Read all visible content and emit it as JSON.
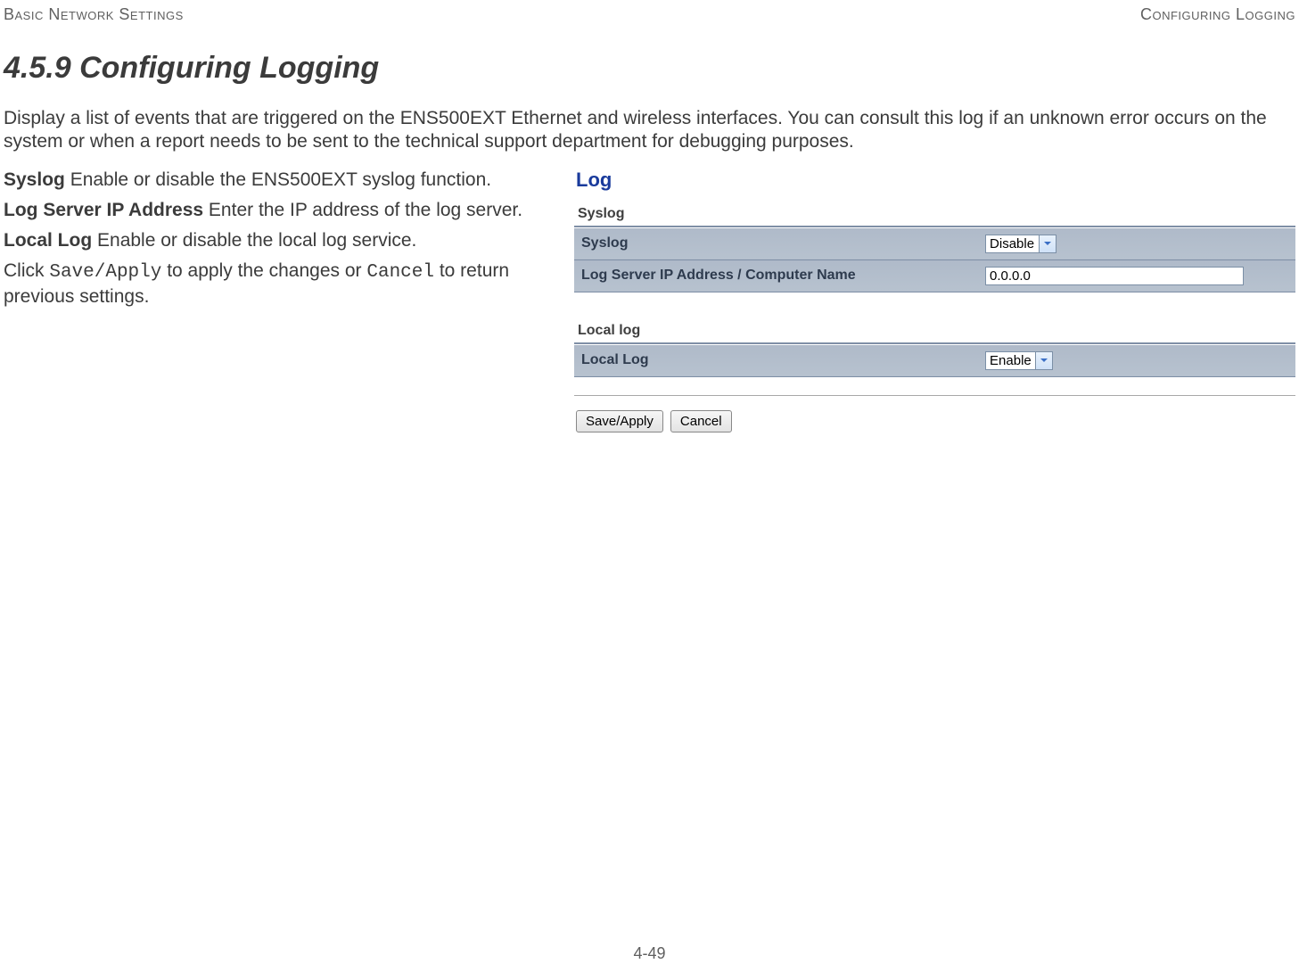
{
  "header": {
    "left": "Basic Network Settings",
    "right": "Configuring Logging"
  },
  "heading": "4.5.9 Configuring Logging",
  "intro": "Display a list of events that are triggered on the ENS500EXT Ethernet and wireless interfaces. You can consult this log if an unknown error occurs on the system or when a report needs to be sent to the technical support department for debugging purposes.",
  "defs": {
    "syslog": {
      "term": "Syslog",
      "desc": "  Enable or disable the ENS500EXT syslog function."
    },
    "logip": {
      "term": "Log Server IP Address",
      "desc": "  Enter the IP address of the log server."
    },
    "locallog": {
      "term": "Local Log",
      "desc": "  Enable or disable the local log service."
    },
    "action_pre": "Click ",
    "action_save": "Save/Apply",
    "action_mid": " to apply the changes or ",
    "action_cancel": "Cancel",
    "action_post": " to return previous settings."
  },
  "panel": {
    "title": "Log",
    "syslog_section": "Syslog",
    "rows": {
      "syslog_label": "Syslog",
      "syslog_value": "Disable",
      "logip_label": "Log Server IP Address / Computer Name",
      "logip_value": "0.0.0.0"
    },
    "locallog_section": "Local log",
    "locallog_label": "Local Log",
    "locallog_value": "Enable",
    "buttons": {
      "save": "Save/Apply",
      "cancel": "Cancel"
    }
  },
  "footer": "4-49"
}
